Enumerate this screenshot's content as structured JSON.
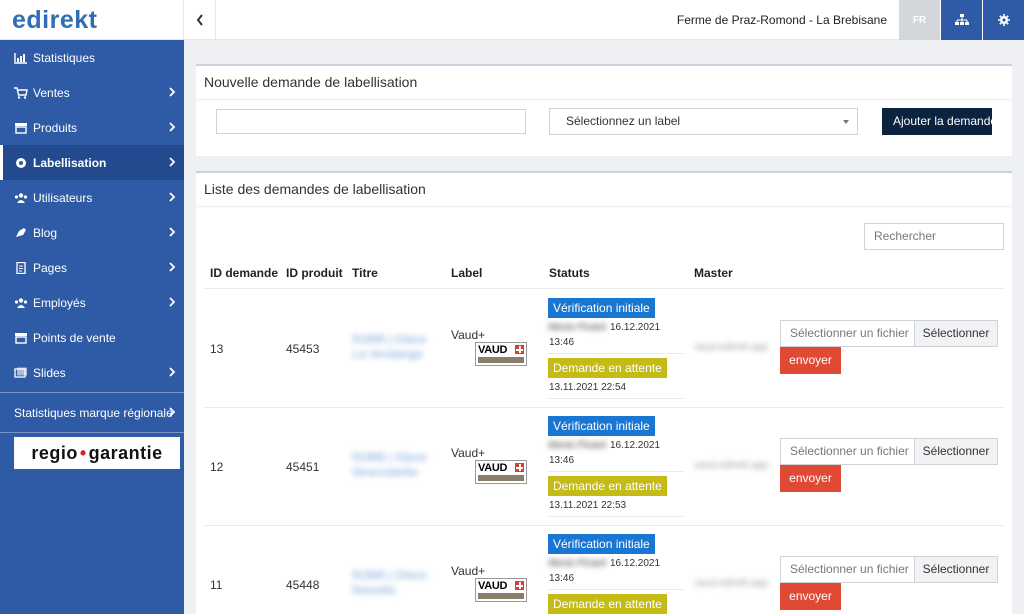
{
  "brand": {
    "logo_text": "edirekt",
    "logo_accent": "#2f6db5"
  },
  "topbar": {
    "farm_name": "Ferme de Praz-Romond - La Brebisane",
    "language": "FR"
  },
  "sidebar": {
    "items": [
      {
        "label": "Statistiques",
        "icon": "chart-icon",
        "chevron": false
      },
      {
        "label": "Ventes",
        "icon": "cart-icon",
        "chevron": true
      },
      {
        "label": "Produits",
        "icon": "store-icon",
        "chevron": true
      },
      {
        "label": "Labellisation",
        "icon": "badge-icon",
        "chevron": true,
        "active": true
      },
      {
        "label": "Utilisateurs",
        "icon": "users-icon",
        "chevron": true
      },
      {
        "label": "Blog",
        "icon": "blog-icon",
        "chevron": true
      },
      {
        "label": "Pages",
        "icon": "page-icon",
        "chevron": true
      },
      {
        "label": "Employés",
        "icon": "employees-icon",
        "chevron": true
      },
      {
        "label": "Points de vente",
        "icon": "store-icon",
        "chevron": false
      },
      {
        "label": "Slides",
        "icon": "slides-icon",
        "chevron": true
      }
    ],
    "regional_stats": "Statistiques marque régionale",
    "regio_logo": "regio garantie"
  },
  "new_request": {
    "title": "Nouvelle demande de labellisation",
    "input_value": "",
    "select_label": "Sélectionnez un label",
    "add_button": "Ajouter la demande"
  },
  "list": {
    "title": "Liste des demandes de labellisation",
    "search_placeholder": "Rechercher",
    "columns": [
      "ID demande",
      "ID produit",
      "Titre",
      "Label",
      "Statuts",
      "Master"
    ],
    "rows": [
      {
        "id": "13",
        "product_id": "45453",
        "title": "91886 | Glace La Vendange",
        "label": "Vaud+",
        "label_badge": "VAUD",
        "status1": "Vérification initiale",
        "status1_user": "Alexis Picard",
        "status1_date": "16.12.2021",
        "status1_time": "13:46",
        "status2": "Demande en attente",
        "status2_datetime": "13.11.2021 22:54",
        "master": "vaud.edirekt.app"
      },
      {
        "id": "12",
        "product_id": "45451",
        "title": "91886 | Glace Stracciatella",
        "label": "Vaud+",
        "label_badge": "VAUD",
        "status1": "Vérification initiale",
        "status1_user": "Alexis Picard",
        "status1_date": "16.12.2021",
        "status1_time": "13:46",
        "status2": "Demande en attente",
        "status2_datetime": "13.11.2021 22:53",
        "master": "vaud.edirekt.app"
      },
      {
        "id": "11",
        "product_id": "45448",
        "title": "91886 | Glace Noisette",
        "label": "Vaud+",
        "label_badge": "VAUD",
        "status1": "Vérification initiale",
        "status1_user": "Alexis Picard",
        "status1_date": "16.12.2021",
        "status1_time": "13:46",
        "status2": "Demande en attente",
        "status2_datetime": "",
        "master": "vaud.edirekt.app"
      }
    ],
    "file_placeholder": "Sélectionner un fichier",
    "file_button": "Sélectionner",
    "send_button": "envoyer"
  },
  "colors": {
    "sidebar": "#2f5ba6",
    "status_blue": "#1976d2",
    "status_olive": "#c4bb17",
    "send_red": "#e04a35",
    "add_dark": "#0c2340"
  }
}
